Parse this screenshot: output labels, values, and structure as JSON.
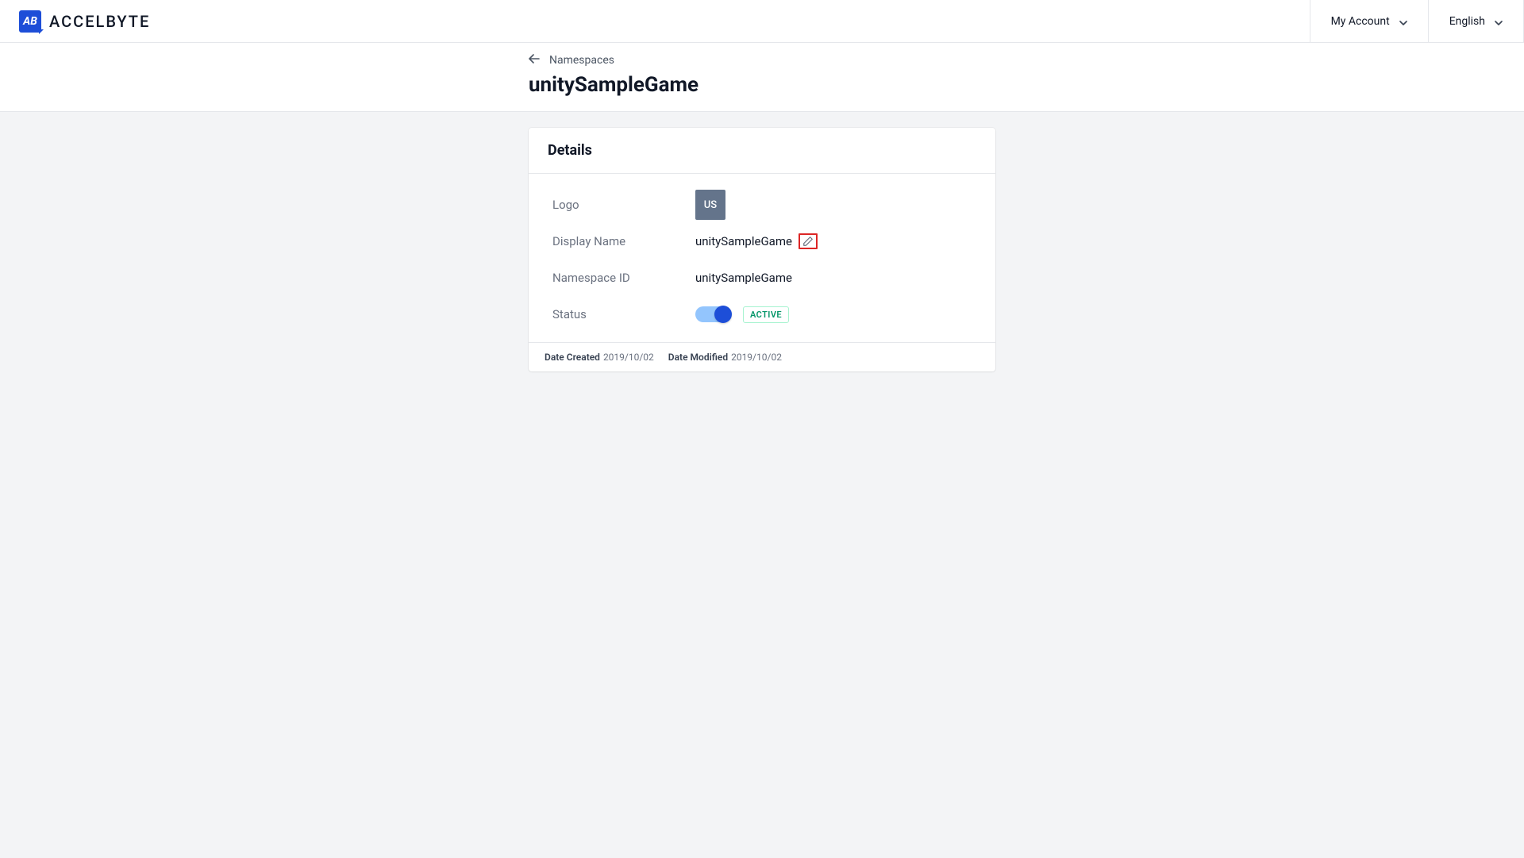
{
  "brand": {
    "logo_initials": "AB",
    "name": "ACCELBYTE"
  },
  "header": {
    "account_label": "My Account",
    "language_label": "English"
  },
  "breadcrumb": {
    "label": "Namespaces"
  },
  "page_title": "unitySampleGame",
  "card": {
    "title": "Details",
    "rows": {
      "logo": {
        "label": "Logo",
        "thumb_text": "US"
      },
      "display_name": {
        "label": "Display Name",
        "value": "unitySampleGame"
      },
      "namespace_id": {
        "label": "Namespace ID",
        "value": "unitySampleGame"
      },
      "status": {
        "label": "Status",
        "badge": "ACTIVE"
      }
    },
    "footer": {
      "created_label": "Date Created",
      "created_value": "2019/10/02",
      "modified_label": "Date Modified",
      "modified_value": "2019/10/02"
    }
  }
}
